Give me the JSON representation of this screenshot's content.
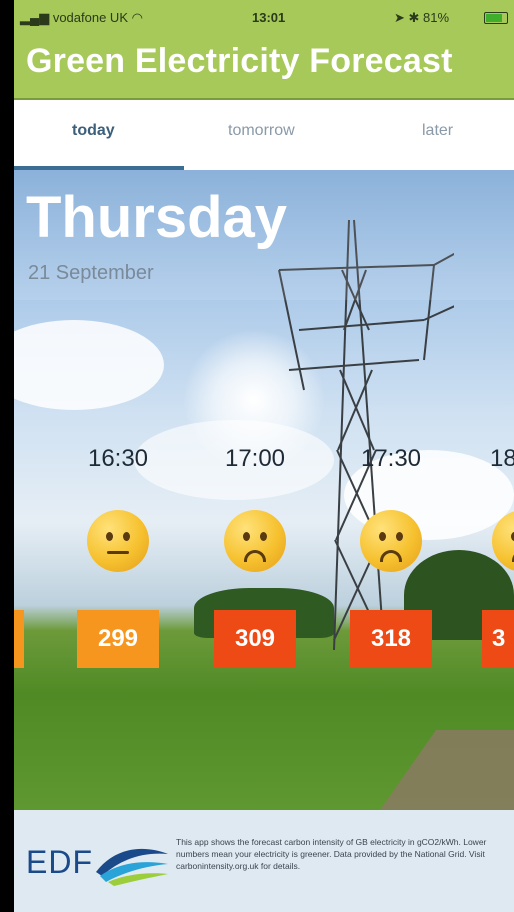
{
  "status_bar": {
    "carrier": "vodafone UK",
    "time": "13:01",
    "battery": "81%"
  },
  "header": {
    "title": "Green Electricity Forecast"
  },
  "tabs": [
    {
      "label": "today",
      "active": true
    },
    {
      "label": "tomorrow",
      "active": false
    },
    {
      "label": "later",
      "active": false
    }
  ],
  "forecast": {
    "day": "Thursday",
    "date": "21 September",
    "slots": [
      {
        "time": "16:30",
        "face": "neutral",
        "value": "299",
        "color": "#f7961e"
      },
      {
        "time": "17:00",
        "face": "sad",
        "value": "309",
        "color": "#ee4a16"
      },
      {
        "time": "17:30",
        "face": "sad",
        "value": "318",
        "color": "#ee4a16"
      },
      {
        "time": "18",
        "face": "sad",
        "value": "3",
        "color": "#ee4a16"
      }
    ],
    "prev_slot": {
      "time": ")",
      "color": "#f7961e"
    }
  },
  "footer": {
    "logo": "EDF",
    "description": "This app shows the forecast carbon intensity of GB electricity in gCO2/kWh. Lower numbers mean your electricity is greener. Data provided by the National Grid. Visit carbonintensity.org.uk for details."
  },
  "colors": {
    "header_bg": "#a6c95a",
    "tab_active": "#3c5f7a",
    "amber": "#f7961e",
    "red_orange": "#ee4a16"
  }
}
